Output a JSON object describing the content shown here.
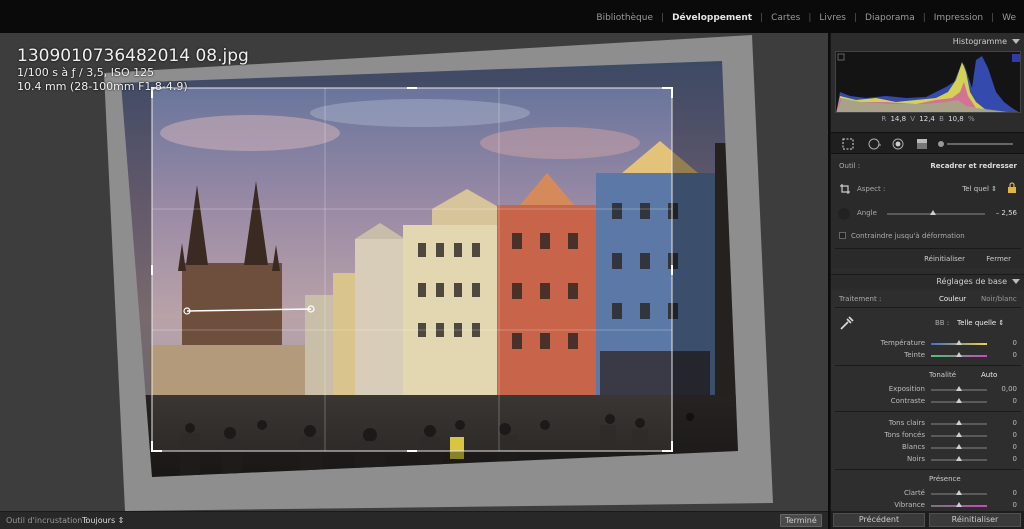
{
  "modules": [
    "Bibliothèque",
    "Développement",
    "Cartes",
    "Livres",
    "Diaporama",
    "Impression",
    "We"
  ],
  "active_module": "Développement",
  "photo": {
    "filename": "1309010736482014 08.jpg",
    "exposure_line": "1/100 s à ƒ / 3,5, ISO 125",
    "lens_line": "10.4 mm (28-100mm F1.8-4.9)"
  },
  "bottom": {
    "overlay_label": "Outil d'incrustation :",
    "overlay_value": "Toujours ⇕",
    "done_button": "Terminé"
  },
  "histogram": {
    "title": "Histogramme",
    "r_label": "R",
    "r_value": "14,8",
    "v_label": "V",
    "v_value": "12,4",
    "b_label": "B",
    "b_value": "10,8",
    "unit": "%"
  },
  "crop": {
    "tool_label": "Outil :",
    "tool_name": "Recadrer et redresser",
    "aspect_label": "Aspect :",
    "aspect_value": "Tel quel ⇕",
    "angle_label": "Angle",
    "angle_value": "– 2,56",
    "angle_level": 0.47,
    "constrain_label": "Contraindre jusqu'à déformation",
    "reset_label": "Réinitialiser",
    "close_label": "Fermer"
  },
  "basic": {
    "title": "Réglages de base",
    "treatment_label": "Traitement :",
    "color_option": "Couleur",
    "bw_option": "Noir/blanc",
    "wb_label": "BB :",
    "wb_value": "Telle quelle ⇕",
    "temperature": {
      "label": "Température",
      "value": "0"
    },
    "tint": {
      "label": "Teinte",
      "value": "0"
    },
    "tone_label": "Tonalité",
    "auto_label": "Auto",
    "exposure": {
      "label": "Exposition",
      "value": "0,00"
    },
    "contrast": {
      "label": "Contraste",
      "value": "0"
    },
    "highlights": {
      "label": "Tons clairs",
      "value": "0"
    },
    "shadows": {
      "label": "Tons foncés",
      "value": "0"
    },
    "whites": {
      "label": "Blancs",
      "value": "0"
    },
    "blacks": {
      "label": "Noirs",
      "value": "0"
    },
    "presence_label": "Présence",
    "clarity": {
      "label": "Clarté",
      "value": "0"
    },
    "vibrance": {
      "label": "Vibrance",
      "value": "0"
    }
  },
  "footer": {
    "previous": "Précédent",
    "reset": "Réinitialiser"
  },
  "colors": {
    "accent": "#ffe94a",
    "panel": "#2c2c2c",
    "workspace": "#3d3d3d",
    "topbar": "#0a0a0a"
  }
}
